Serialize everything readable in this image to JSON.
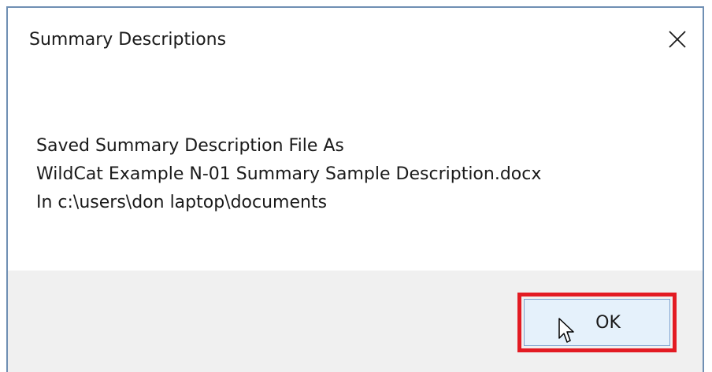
{
  "dialog": {
    "title": "Summary Descriptions",
    "close_icon": "close-icon",
    "message": {
      "line1": "Saved Summary Description File As",
      "line2": "WildCat Example N-01 Summary Sample Description.docx",
      "line3": "In c:\\users\\don laptop\\documents"
    },
    "ok_label": "OK"
  },
  "colors": {
    "window_border": "#6f8fb3",
    "footer_bg": "#f0f0f0",
    "button_bg": "#e5f1fb",
    "button_border": "#7da2ce",
    "highlight": "#e31b23"
  },
  "pointer_icon": "mouse-pointer-icon"
}
